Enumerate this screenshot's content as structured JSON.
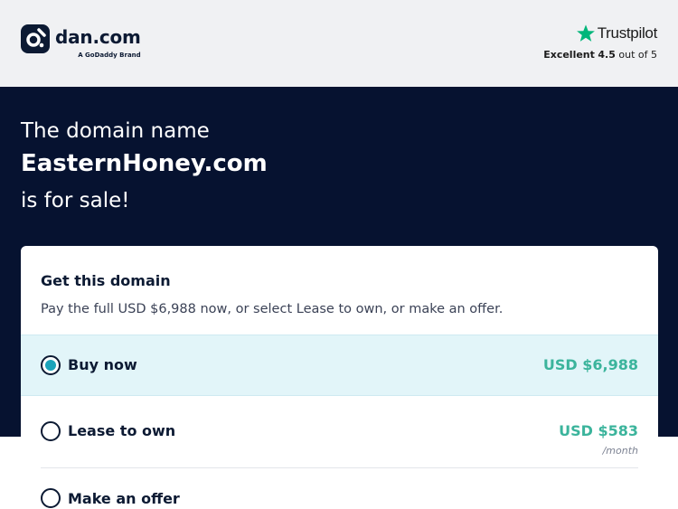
{
  "header": {
    "logo_name": "dan.com",
    "logo_sub": "A GoDaddy Brand",
    "trustpilot_name": "Trustpilot",
    "trustpilot_rating_label": "Excellent",
    "trustpilot_score": "4.5",
    "trustpilot_suffix": "out of 5",
    "trustpilot_star_color": "#00b67a"
  },
  "hero": {
    "line1": "The domain name",
    "domain": "EasternHoney.com",
    "line3": "is for sale!"
  },
  "card": {
    "title": "Get this domain",
    "description": "Pay the full USD $6,988 now, or select Lease to own, or make an offer.",
    "options": [
      {
        "label": "Buy now",
        "price": "USD $6,988",
        "unit": "",
        "selected": true
      },
      {
        "label": "Lease to own",
        "price": "USD $583",
        "unit": "/month",
        "selected": false
      },
      {
        "label": "Make an offer",
        "price": "",
        "unit": "",
        "selected": false
      }
    ]
  },
  "colors": {
    "navy": "#061230",
    "accent_teal": "#1ba3ba",
    "price_green": "#3bb49c",
    "selected_bg": "#e2f5f9"
  }
}
